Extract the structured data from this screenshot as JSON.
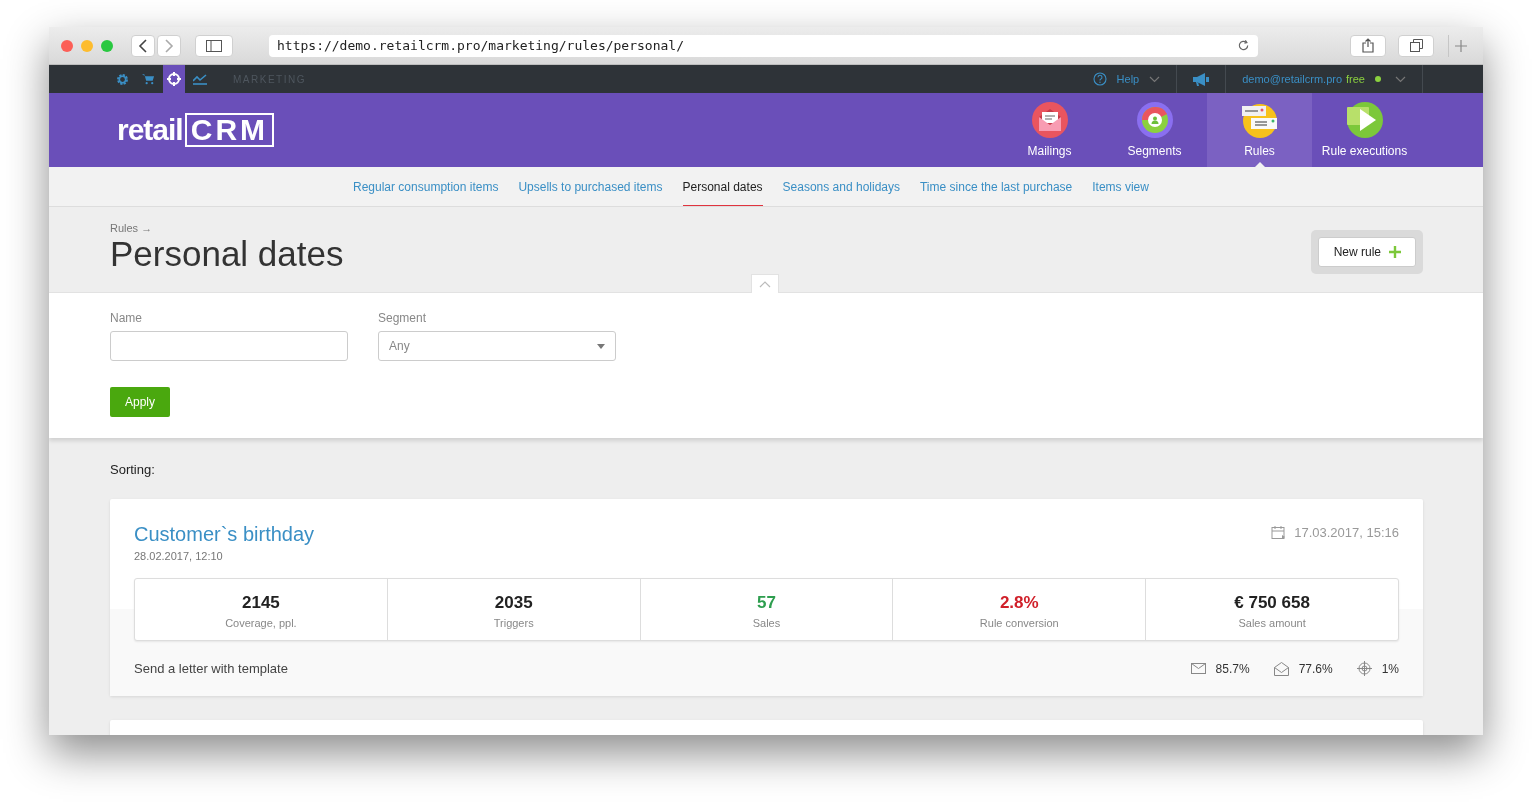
{
  "browser": {
    "url": "https://demo.retailcrm.pro/marketing/rules/personal/"
  },
  "topbar": {
    "modules": [
      {
        "kind": "gear",
        "selected": false
      },
      {
        "kind": "cart",
        "selected": false
      },
      {
        "kind": "target",
        "selected": true
      },
      {
        "kind": "chart",
        "selected": false
      }
    ],
    "section": "MARKETING",
    "help": "Help",
    "email": "demo@retailcrm.pro",
    "plan": "free",
    "online": true
  },
  "header": {
    "logo_main": "retail",
    "logo_brand": "CRM",
    "nav": [
      {
        "label": "Mailings",
        "kind": "mailings",
        "selected": false
      },
      {
        "label": "Segments",
        "kind": "segments",
        "selected": false
      },
      {
        "label": "Rules",
        "kind": "rules",
        "selected": true
      },
      {
        "label": "Rule executions",
        "kind": "executions",
        "selected": false
      }
    ]
  },
  "subnav": [
    {
      "label": "Regular consumption items",
      "selected": false
    },
    {
      "label": "Upsells to purchased items",
      "selected": false
    },
    {
      "label": "Personal dates",
      "selected": true
    },
    {
      "label": "Seasons and holidays",
      "selected": false
    },
    {
      "label": "Time since the last purchase",
      "selected": false
    },
    {
      "label": "Items view",
      "selected": false
    }
  ],
  "page": {
    "breadcrumb": "Rules →",
    "title": "Personal dates",
    "new_button": "New rule"
  },
  "filters": {
    "name_label": "Name",
    "segment_label": "Segment",
    "segment_value": "Any",
    "apply": "Apply"
  },
  "sorting_label": "Sorting:",
  "rules": [
    {
      "title": "Customer`s birthday",
      "created": "28.02.2017, 12:10",
      "scheduled": "17.03.2017, 15:16",
      "stats": [
        {
          "value": "2145",
          "label": "Coverage, ppl.",
          "kind": "neutral"
        },
        {
          "value": "2035",
          "label": "Triggers",
          "kind": "neutral"
        },
        {
          "value": "57",
          "label": "Sales",
          "kind": "positive"
        },
        {
          "value": "2.8%",
          "label": "Rule conversion",
          "kind": "negative"
        },
        {
          "value": "€ 750 658",
          "label": "Sales amount",
          "kind": "neutral"
        }
      ],
      "action": "Send a letter with template",
      "metrics": [
        {
          "kind": "delivered",
          "value": "85.7%"
        },
        {
          "kind": "opened",
          "value": "77.6%"
        },
        {
          "kind": "clicked",
          "value": "1%"
        }
      ]
    }
  ]
}
